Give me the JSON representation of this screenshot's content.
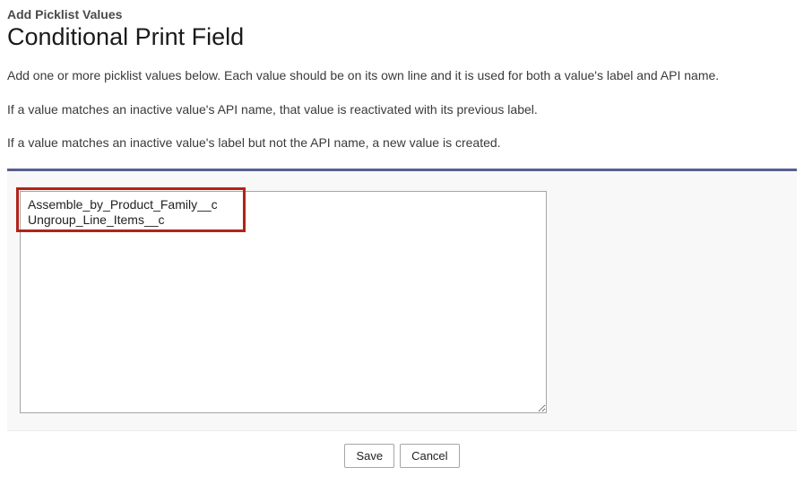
{
  "header": {
    "subtitle": "Add Picklist Values",
    "title": "Conditional Print Field"
  },
  "description": {
    "line1": "Add one or more picklist values below. Each value should be on its own line and it is used for both a value's label and API name.",
    "line2": "If a value matches an inactive value's API name, that value is reactivated with its previous label.",
    "line3": "If a value matches an inactive value's label but not the API name, a new value is created."
  },
  "form": {
    "textarea_value": "Assemble_by_Product_Family__c\nUngroup_Line_Items__c"
  },
  "buttons": {
    "save": "Save",
    "cancel": "Cancel"
  }
}
